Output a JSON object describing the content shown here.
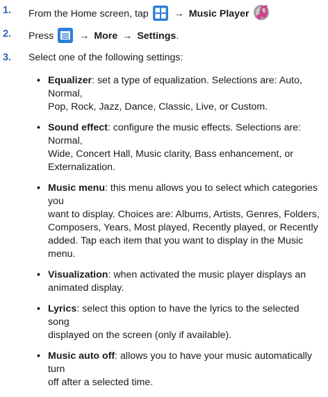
{
  "steps": [
    {
      "num": "1.",
      "text_before": "From the Home screen, tap",
      "arrow": "→",
      "target": "Music Player",
      "icons": [
        "apps-grid-icon",
        "music-player-icon"
      ],
      "colors": {
        "apps": "#2f7fd6",
        "music": "#d63c8c"
      }
    },
    {
      "num": "2.",
      "text_before": "Press",
      "arrow1": "→",
      "more": "More",
      "arrow2": "→",
      "settings": "Settings",
      "period": ".",
      "icons": [
        "menu-key-icon"
      ]
    },
    {
      "num": "3.",
      "text": "Select one of the following settings:"
    }
  ],
  "settings": [
    {
      "term": "Equalizer",
      "lines": [
        ": set a type of equalization. Selections are: Auto, Normal,",
        "Pop, Rock, Jazz, Dance, Classic, Live, or Custom."
      ]
    },
    {
      "term": "Sound effect",
      "lines": [
        ": configure the music effects. Selections are: Normal,",
        "Wide, Concert Hall, Music clarity, Bass enhancement, or",
        "Externalization."
      ]
    },
    {
      "term": "Music menu",
      "lines": [
        ": this menu allows you to select which categories you",
        "want to display. Choices are: Albums, Artists, Genres, Folders,",
        "Composers, Years, Most played, Recently played, or Recently",
        "added. Tap each item that you want to display in the Music menu."
      ]
    },
    {
      "term": "Visualization",
      "lines": [
        ": when activated the music player displays an",
        "animated display."
      ]
    },
    {
      "term": "Lyrics",
      "lines": [
        ": select this option to have the lyrics to the selected song",
        "displayed on the screen (only if available)."
      ]
    },
    {
      "term": "Music auto off",
      "lines": [
        ": allows you to have your music automatically turn",
        "off after a selected time."
      ]
    }
  ],
  "bullet_glyph": "•"
}
